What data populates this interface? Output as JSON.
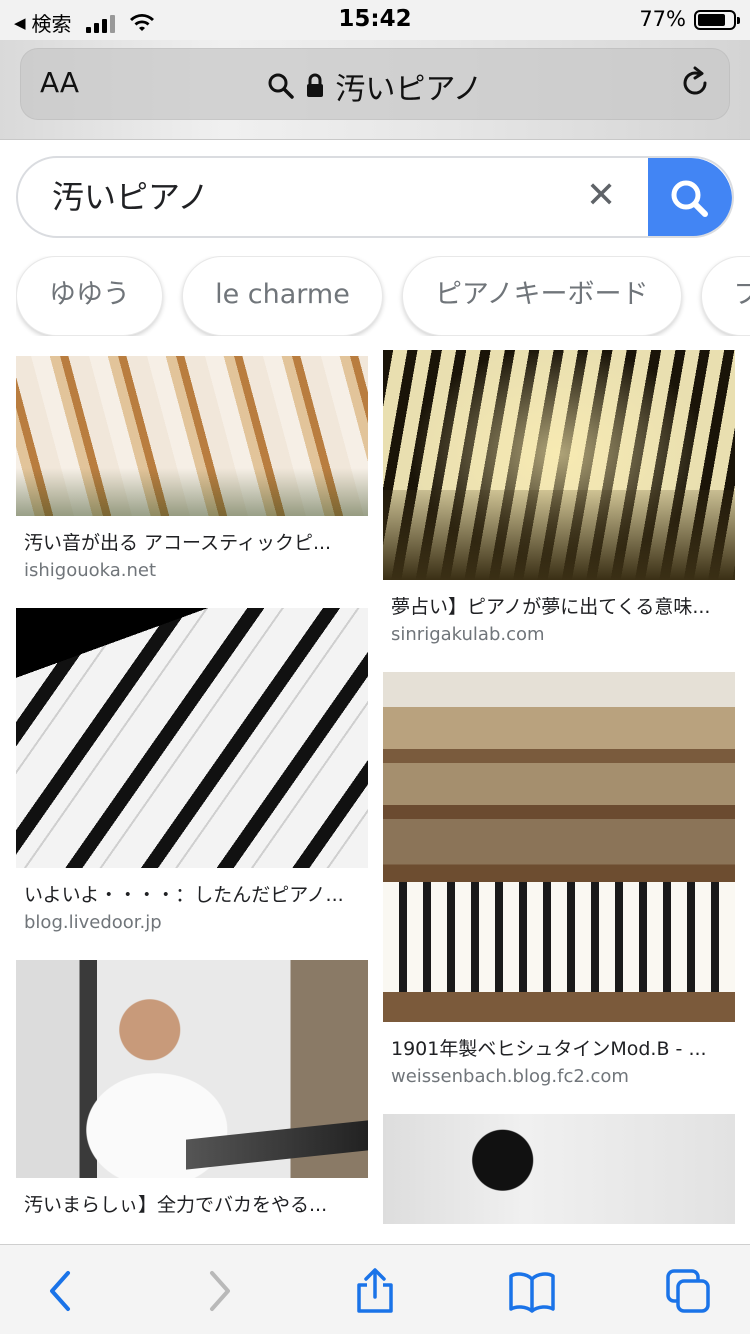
{
  "status_bar": {
    "back_app": "検索",
    "time": "15:42",
    "battery": "77%"
  },
  "browser": {
    "text_size": "AA",
    "url_text": "汚いピアノ"
  },
  "search": {
    "query": "汚いピアノ",
    "clear_label": "✕"
  },
  "chips": [
    {
      "label": "ゆゆう"
    },
    {
      "label": "le charme"
    },
    {
      "label": "ピアノキーボード"
    },
    {
      "label": "プ"
    }
  ],
  "results": {
    "left": [
      {
        "title": "汚い音が出る アコースティックピ...",
        "source": "ishigouoka.net"
      },
      {
        "title": "いよいよ・・・・：したんだピアノ...",
        "source": "blog.livedoor.jp"
      },
      {
        "title": "汚いまらしぃ】全力でバカをやる...",
        "source": ""
      }
    ],
    "right": [
      {
        "title": "夢占い】ピアノが夢に出てくる意味...",
        "source": "sinrigakulab.com"
      },
      {
        "title": "1901年製ベヒシュタインMod.B - ...",
        "source": "weissenbach.blog.fc2.com"
      }
    ]
  },
  "colors": {
    "accent_blue": "#4285f4",
    "safari_blue": "#1a73e8"
  }
}
